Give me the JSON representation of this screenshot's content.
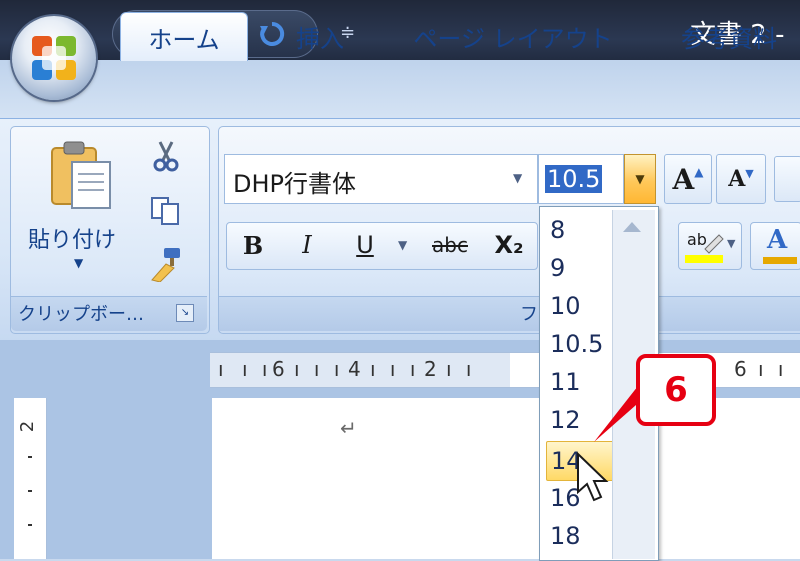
{
  "window": {
    "title": "文書 2 -"
  },
  "quick_access": {
    "icons": [
      "save-icon",
      "undo-icon",
      "repeat-icon",
      "customize-icon"
    ]
  },
  "tabs": [
    {
      "label": "ホーム",
      "active": true
    },
    {
      "label": "挿入"
    },
    {
      "label": "ページ レイアウト"
    },
    {
      "label": "参考資料"
    }
  ],
  "clipboard": {
    "paste_label": "貼り付け",
    "group_label": "クリップボー…"
  },
  "font": {
    "font_name": "DHP行書体",
    "font_size": "10.5",
    "group_label": "フ",
    "format_buttons": [
      "B",
      "I",
      "U",
      "abc",
      "X₂"
    ]
  },
  "font_size_list": {
    "options": [
      "8",
      "9",
      "10",
      "10.5",
      "11",
      "12",
      "14",
      "16",
      "18"
    ],
    "highlighted": "14"
  },
  "ruler": {
    "ticks": [
      "6",
      "4",
      "2",
      "6"
    ],
    "vertical": [
      "2"
    ]
  },
  "document": {
    "paragraph_mark": "↵"
  },
  "callout": {
    "number": "6"
  },
  "colors": {
    "accent": "#e60012",
    "title_bar": "#20283a",
    "ribbon": "#d8e6f7",
    "highlight": "#ffd966"
  }
}
